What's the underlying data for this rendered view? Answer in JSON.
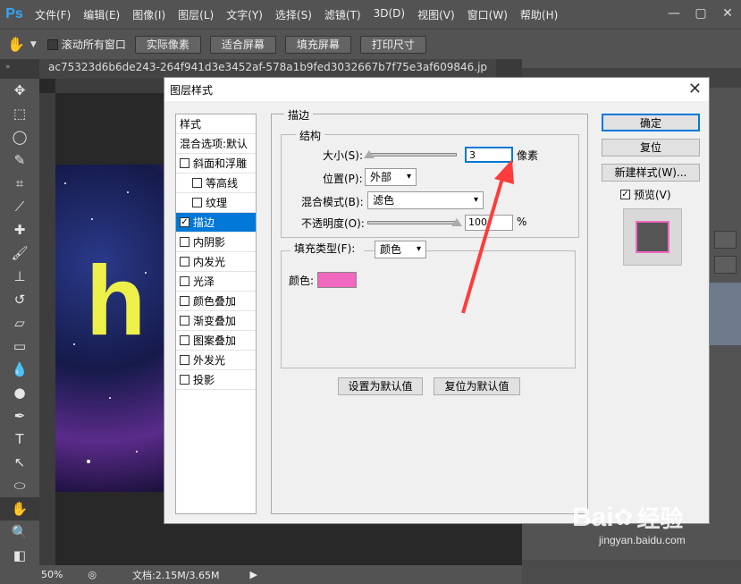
{
  "app": {
    "logo": "Ps",
    "menu": [
      "文件(F)",
      "编辑(E)",
      "图像(I)",
      "图层(L)",
      "文字(Y)",
      "选择(S)",
      "滤镜(T)",
      "3D(D)",
      "视图(V)",
      "窗口(W)",
      "帮助(H)"
    ]
  },
  "options_bar": {
    "scroll_all": "滚动所有窗口",
    "buttons": [
      "实际像素",
      "适合屏幕",
      "填充屏幕",
      "打印尺寸"
    ]
  },
  "document": {
    "tab_name": "ac75323d6b6de243-264f941d3e3452af-578a1b9fed3032667b7f75e3af609846.jp",
    "canvas_text": "h",
    "zoom": "50%",
    "doc_size": "文档:2.15M/3.65M"
  },
  "dialog": {
    "title": "图层样式",
    "styles_header": "样式",
    "blend_options": "混合选项:默认",
    "effects": [
      {
        "label": "斜面和浮雕",
        "checked": false,
        "sub": false,
        "selected": false
      },
      {
        "label": "等高线",
        "checked": false,
        "sub": true,
        "selected": false
      },
      {
        "label": "纹理",
        "checked": false,
        "sub": true,
        "selected": false
      },
      {
        "label": "描边",
        "checked": true,
        "sub": false,
        "selected": true
      },
      {
        "label": "内阴影",
        "checked": false,
        "sub": false,
        "selected": false
      },
      {
        "label": "内发光",
        "checked": false,
        "sub": false,
        "selected": false
      },
      {
        "label": "光泽",
        "checked": false,
        "sub": false,
        "selected": false
      },
      {
        "label": "颜色叠加",
        "checked": false,
        "sub": false,
        "selected": false
      },
      {
        "label": "渐变叠加",
        "checked": false,
        "sub": false,
        "selected": false
      },
      {
        "label": "图案叠加",
        "checked": false,
        "sub": false,
        "selected": false
      },
      {
        "label": "外发光",
        "checked": false,
        "sub": false,
        "selected": false
      },
      {
        "label": "投影",
        "checked": false,
        "sub": false,
        "selected": false
      }
    ],
    "stroke_title": "描边",
    "structure_title": "结构",
    "size_label": "大小(S):",
    "size_value": "3",
    "size_unit": "像素",
    "position_label": "位置(P):",
    "position_value": "外部",
    "blend_label": "混合模式(B):",
    "blend_value": "滤色",
    "opacity_label": "不透明度(O):",
    "opacity_value": "100",
    "opacity_unit": "%",
    "fill_type_label": "填充类型(F):",
    "fill_type_value": "颜色",
    "color_label": "颜色:",
    "stroke_color": "#f068c0",
    "set_default": "设置为默认值",
    "reset_default": "复位为默认值",
    "ok": "确定",
    "reset": "复位",
    "new_style": "新建样式(W)...",
    "preview_label": "预览(V)",
    "preview_checked": true
  },
  "watermark": {
    "brand": "Bai",
    "brand2": "经验",
    "url": "jingyan.baidu.com"
  }
}
